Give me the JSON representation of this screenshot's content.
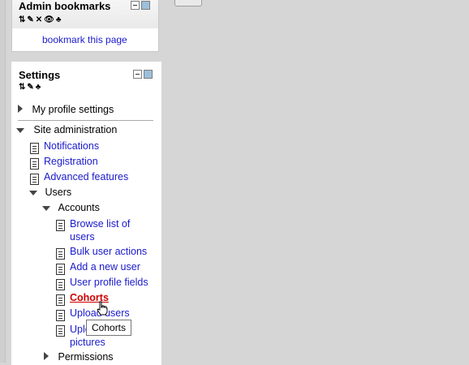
{
  "admin_bookmarks": {
    "title": "Admin bookmarks",
    "link": "bookmark this page"
  },
  "settings": {
    "title": "Settings",
    "tree": {
      "my_profile": "My profile settings",
      "site_admin": "Site administration",
      "site_items": [
        "Notifications",
        "Registration",
        "Advanced features"
      ],
      "users": "Users",
      "accounts": "Accounts",
      "account_items": [
        "Browse list of users",
        "Bulk user actions",
        "Add a new user",
        "User profile fields",
        "Cohorts",
        "Upload users",
        "Upload user pictures"
      ],
      "permissions": "Permissions"
    }
  },
  "tooltip": "Cohorts",
  "colors": {
    "link": "#1a1acc",
    "active_link": "#cc0000"
  }
}
